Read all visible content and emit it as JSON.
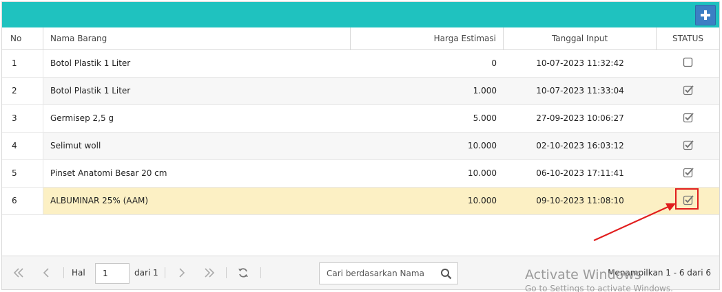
{
  "toolbar": {
    "add_icon": "plus-icon",
    "accent_color": "#1fc2bf",
    "add_button_color": "#3c7fc4"
  },
  "table": {
    "headers": {
      "no": "No",
      "nama": "Nama Barang",
      "harga": "Harga Estimasi",
      "tanggal": "Tanggal Input",
      "status": "STATUS"
    },
    "rows": [
      {
        "no": "1",
        "nama": "Botol Plastik 1 Liter",
        "harga": "0",
        "tanggal": "10-07-2023 11:32:42",
        "status": false
      },
      {
        "no": "2",
        "nama": "Botol Plastik 1 Liter",
        "harga": "1.000",
        "tanggal": "10-07-2023 11:33:04",
        "status": true
      },
      {
        "no": "3",
        "nama": "Germisep 2,5 g",
        "harga": "5.000",
        "tanggal": "27-09-2023 10:06:27",
        "status": true
      },
      {
        "no": "4",
        "nama": "Selimut woll",
        "harga": "10.000",
        "tanggal": "02-10-2023 16:03:12",
        "status": true
      },
      {
        "no": "5",
        "nama": "Pinset Anatomi Besar 20 cm",
        "harga": "10.000",
        "tanggal": "06-10-2023 17:11:41",
        "status": true
      },
      {
        "no": "6",
        "nama": "ALBUMINAR 25% (AAM)",
        "harga": "10.000",
        "tanggal": "09-10-2023 11:08:10",
        "status": true
      }
    ]
  },
  "pagination": {
    "hal_label": "Hal",
    "page_value": "1",
    "dari_label": "dari 1",
    "search_placeholder": "Cari berdasarkan Nama",
    "status_text": "Menampilkan 1 - 6 dari 6"
  },
  "watermark": {
    "title": "Activate Windows",
    "subtitle": "Go to Settings to activate Windows."
  }
}
